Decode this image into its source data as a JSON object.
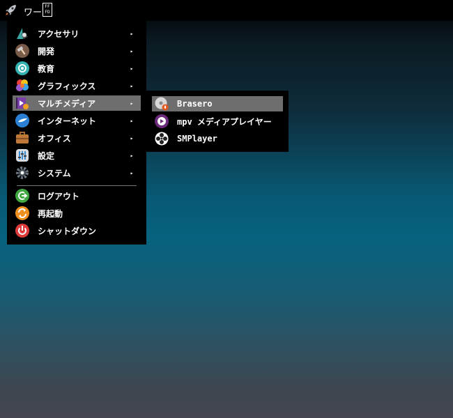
{
  "panel": {
    "launcher_icon": "rocket-icon",
    "window_title": "ワー",
    "hex_glyph": "FF\nFD"
  },
  "main_menu": {
    "items": [
      {
        "label": "アクセサリ",
        "icon": "accessories-icon",
        "has_submenu": true
      },
      {
        "label": "開発",
        "icon": "development-hammer-icon",
        "has_submenu": true
      },
      {
        "label": "教育",
        "icon": "education-icon",
        "has_submenu": true
      },
      {
        "label": "グラフィックス",
        "icon": "graphics-icon",
        "has_submenu": true
      },
      {
        "label": "マルチメディア",
        "icon": "multimedia-icon",
        "has_submenu": true,
        "highlighted": true
      },
      {
        "label": "インターネット",
        "icon": "internet-globe-icon",
        "has_submenu": true
      },
      {
        "label": "オフィス",
        "icon": "office-briefcase-icon",
        "has_submenu": true
      },
      {
        "label": "設定",
        "icon": "settings-icon",
        "has_submenu": true
      },
      {
        "label": "システム",
        "icon": "system-gear-icon",
        "has_submenu": true
      }
    ],
    "session_items": [
      {
        "label": "ログアウト",
        "icon": "logout-icon"
      },
      {
        "label": "再起動",
        "icon": "reboot-icon"
      },
      {
        "label": "シャットダウン",
        "icon": "shutdown-icon"
      }
    ],
    "submenu_arrow": "▸"
  },
  "submenu": {
    "items": [
      {
        "label": "Brasero",
        "icon": "brasero-disc-icon",
        "highlighted": true
      },
      {
        "label": "mpv メディアプレイヤー",
        "icon": "mpv-icon"
      },
      {
        "label": "SMPlayer",
        "icon": "smplayer-icon"
      }
    ]
  },
  "colors": {
    "menu_bg": "#000000",
    "highlight_bg": "#6e6e6e",
    "text": "#ffffff"
  }
}
